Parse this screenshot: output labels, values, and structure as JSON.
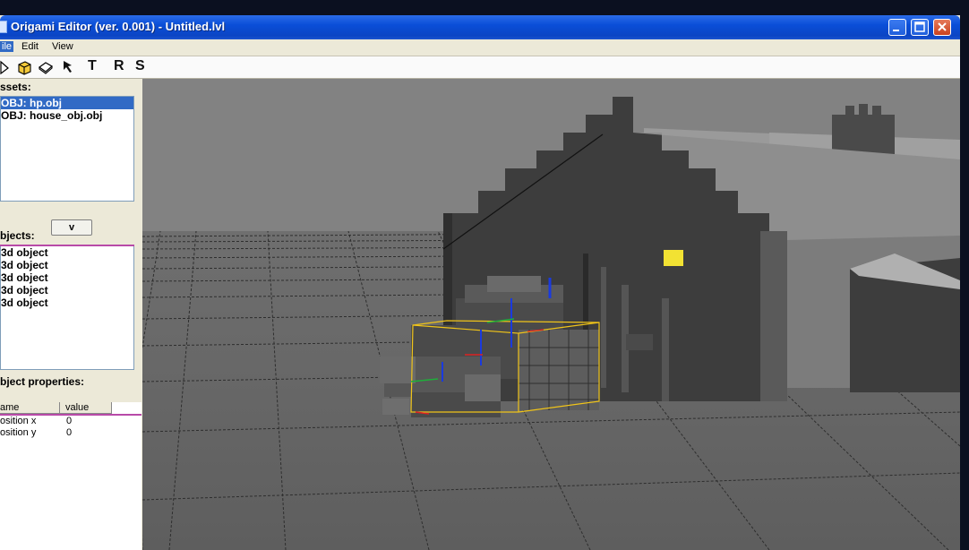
{
  "window": {
    "title": "Origami Editor (ver. 0.001) - Untitled.lvl"
  },
  "menu": {
    "items": [
      {
        "label": "ile"
      },
      {
        "label": "Edit"
      },
      {
        "label": "View"
      }
    ]
  },
  "toolbar": {
    "tools": [
      {
        "icon": "select-arrow-icon"
      },
      {
        "icon": "cube-icon"
      },
      {
        "icon": "plane-icon"
      },
      {
        "icon": "pointer-icon"
      }
    ],
    "text_tools": [
      "T",
      "R",
      "S"
    ]
  },
  "assets": {
    "label": "ssets:",
    "items": [
      {
        "label": "OBJ: hp.obj",
        "selected": true
      },
      {
        "label": "OBJ: house_obj.obj",
        "selected": false
      }
    ]
  },
  "objects": {
    "label": "bjects:",
    "dropdown": "v",
    "items": [
      "3d object",
      "3d object",
      "3d object",
      "3d object",
      "3d object"
    ]
  },
  "properties": {
    "label": "bject properties:",
    "columns": [
      "ame",
      "value"
    ],
    "rows": [
      {
        "name": "osition x",
        "value": "0"
      },
      {
        "name": "osition y",
        "value": "0"
      }
    ]
  },
  "colors": {
    "title_bar": "#0a4ed8",
    "selection": "#316ac5",
    "viewport_sky": "#808080",
    "gizmo_yellow": "#f0c419",
    "window_light": "#f2e233"
  }
}
